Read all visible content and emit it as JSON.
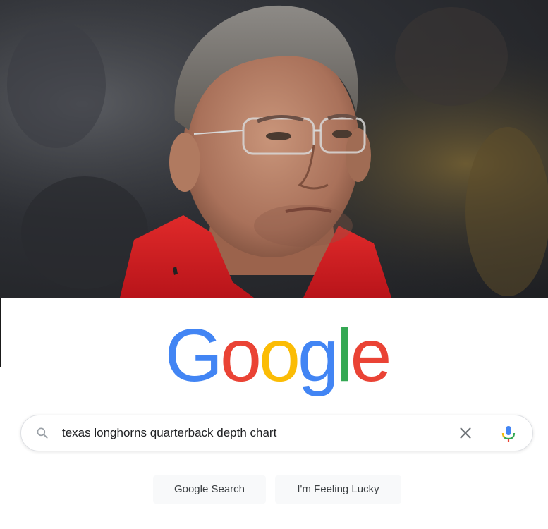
{
  "photo": {
    "description_icon": "man-portrait-photo"
  },
  "logo": {
    "letters": [
      "G",
      "o",
      "o",
      "g",
      "l",
      "e"
    ],
    "colors": [
      "#4285F4",
      "#EA4335",
      "#FBBC05",
      "#4285F4",
      "#34A853",
      "#EA4335"
    ]
  },
  "search": {
    "value": "texas longhorns quarterback depth chart",
    "search_icon": "search-icon",
    "clear_icon": "close-icon",
    "mic_icon": "microphone-icon"
  },
  "buttons": {
    "search_label": "Google Search",
    "lucky_label": "I'm Feeling Lucky"
  },
  "colors": {
    "blue": "#4285F4",
    "red": "#EA4335",
    "yellow": "#FBBC05",
    "green": "#34A853",
    "button_bg": "#f8f9fa",
    "text": "#3c4043"
  }
}
